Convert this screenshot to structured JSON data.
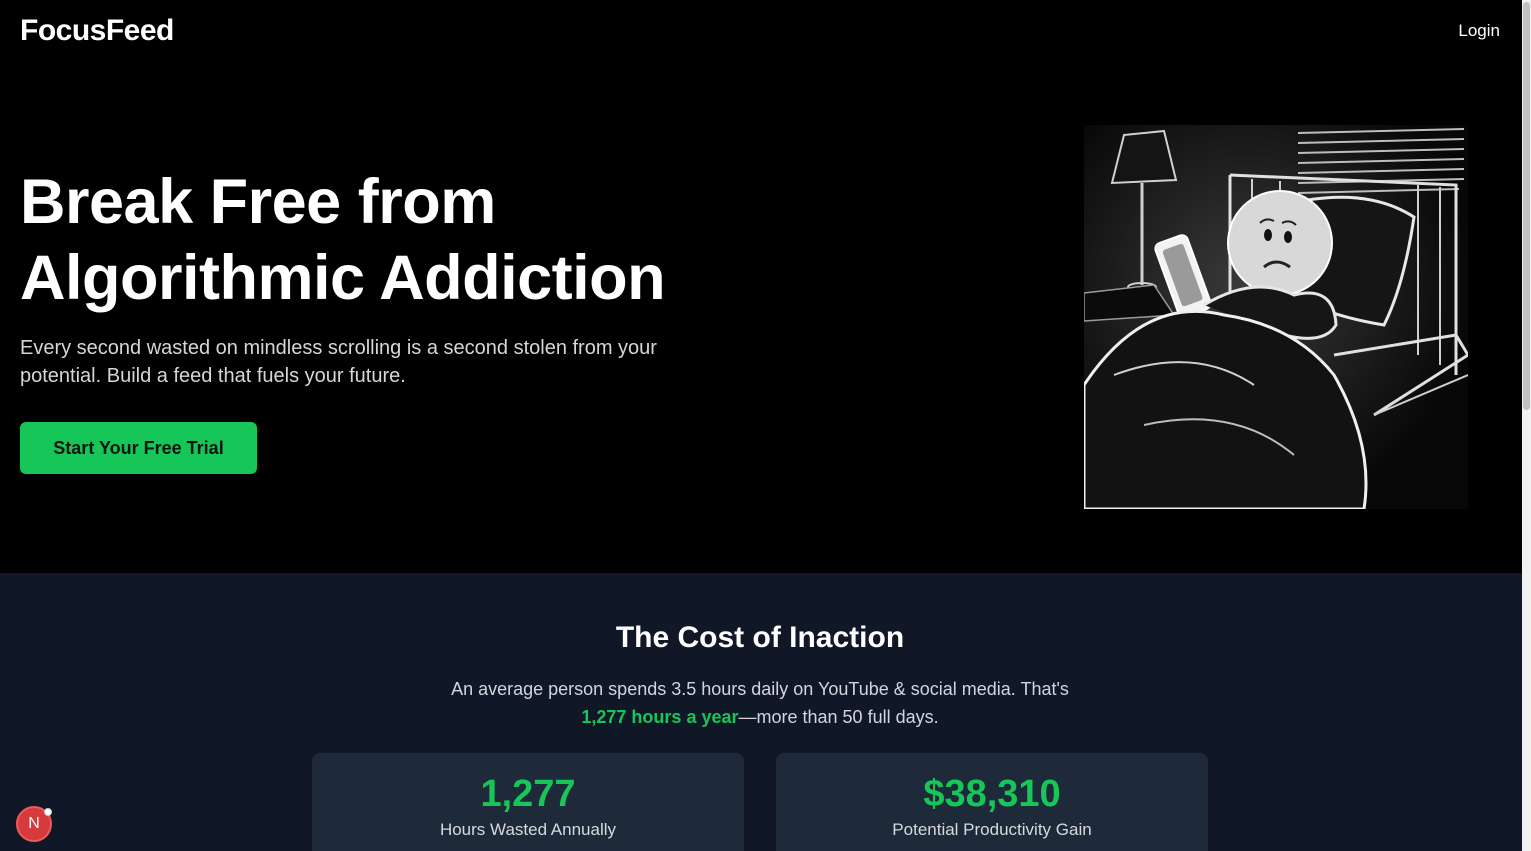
{
  "nav": {
    "logo": "FocusFeed",
    "login_label": "Login"
  },
  "hero": {
    "title_line1": "Break Free from",
    "title_line2": "Algorithmic Addiction",
    "subtitle_line1": "Every second wasted on mindless scrolling is a second stolen from your",
    "subtitle_line2": "potential. Build a feed that fuels your future.",
    "cta_label": "Start Your Free Trial"
  },
  "cost": {
    "title": "The Cost of Inaction",
    "desc_part1": "An average person spends 3.5 hours daily on YouTube & social media. That's",
    "desc_highlight": "1,277 hours a year",
    "desc_part2": "—more than 50 full days.",
    "cards": [
      {
        "value": "1,277",
        "label": "Hours Wasted Annually"
      },
      {
        "value": "$38,310",
        "label": "Potential Productivity Gain"
      }
    ]
  },
  "dev_badge": {
    "letter": "N"
  },
  "colors": {
    "accent": "#16c658",
    "section_bg": "#101828",
    "card_bg": "#1e2939"
  },
  "icons": {
    "dev_badge": "nextjs-logo-icon"
  }
}
